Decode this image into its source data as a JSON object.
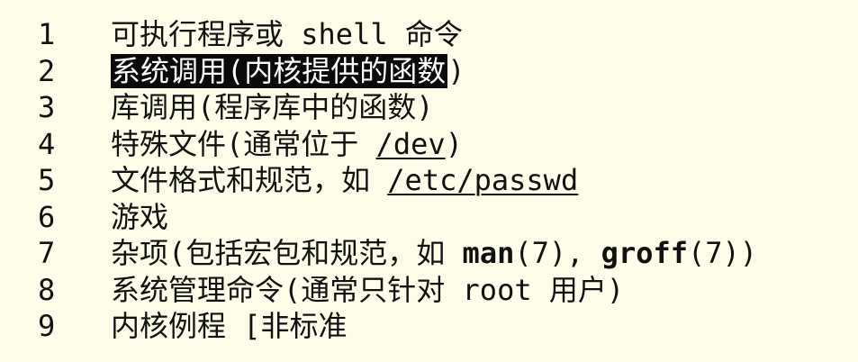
{
  "sections": [
    {
      "number": "1",
      "parts": [
        "可执行程序或 shell 命令"
      ]
    },
    {
      "number": "2",
      "highlight": "系统调用(内核提供的函数",
      "rest": ")"
    },
    {
      "number": "3",
      "parts": [
        "库调用(程序库中的函数)"
      ]
    },
    {
      "number": "4",
      "pre": "特殊文件(通常位于 ",
      "path": "/dev",
      "post": ")"
    },
    {
      "number": "5",
      "pre": "文件格式和规范，如 ",
      "path": "/etc/passwd",
      "post": ""
    },
    {
      "number": "6",
      "parts": [
        "游戏"
      ]
    },
    {
      "number": "7",
      "pre": "杂项(包括宏包和规范，如 ",
      "cmd1": "man",
      "mid": "(7), ",
      "cmd2": "groff",
      "post": "(7))"
    },
    {
      "number": "8",
      "parts": [
        "系统管理命令(通常只针对 root 用户)"
      ]
    },
    {
      "number": "9",
      "parts": [
        "内核例程 [非标准"
      ]
    }
  ]
}
